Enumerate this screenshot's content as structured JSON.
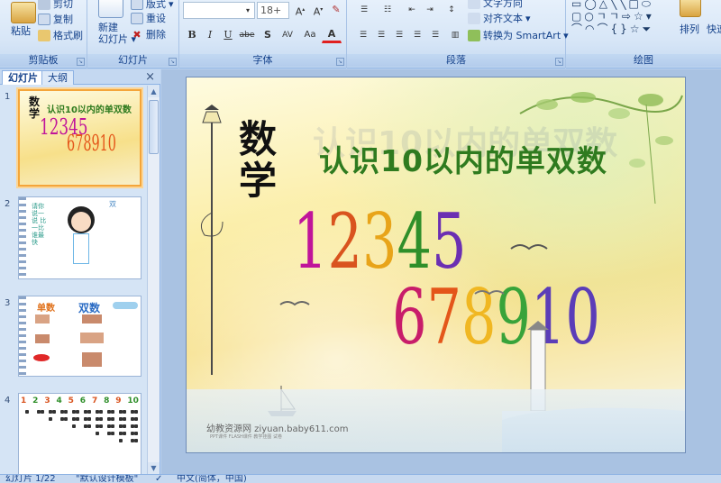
{
  "ribbon": {
    "clipboard": {
      "paste": "粘贴",
      "cut": "剪切",
      "copy": "复制",
      "format_painter": "格式刷",
      "label": "剪贴板"
    },
    "slides": {
      "new_slide_line1": "新建",
      "new_slide_line2": "幻灯片",
      "layout": "版式",
      "reset": "重设",
      "delete": "删除",
      "label": "幻灯片"
    },
    "font": {
      "font_name": "",
      "font_size": "18+",
      "label": "字体",
      "bold": "B",
      "italic": "I",
      "underline": "U",
      "strike": "abe",
      "shadow": "S",
      "spacing": "AV",
      "case": "Aa",
      "color": "A"
    },
    "paragraph": {
      "text_direction": "文字方向",
      "align_text": "对齐文本",
      "smartart": "转换为 SmartArt",
      "label": "段落"
    },
    "drawing": {
      "arrange": "排列",
      "quick_styles": "快速",
      "label": "绘图"
    }
  },
  "left_pane": {
    "tabs": [
      {
        "label": "幻灯片"
      },
      {
        "label": "大纲"
      }
    ],
    "close": "×",
    "thumbnails": [
      {
        "num": "1",
        "big": "数学",
        "title": "认识10以内的单双数",
        "row1": "12345",
        "row2": "678910"
      },
      {
        "num": "2",
        "caption": "双",
        "side_text": "请你说一说 比一比谁最快"
      },
      {
        "num": "3",
        "left": "单数",
        "right": "双数"
      },
      {
        "num": "4",
        "numbers": [
          "1",
          "2",
          "3",
          "4",
          "5",
          "6",
          "7",
          "8",
          "9",
          "10"
        ]
      }
    ]
  },
  "slide": {
    "big_title": "数学",
    "title": "认识10以内的单双数",
    "ghost_title": "认识10以内的单双数",
    "row1": [
      "1",
      "2",
      "3",
      "4",
      "5"
    ],
    "row2": [
      "6",
      "7",
      "8",
      "9",
      "10"
    ],
    "watermark": "幼教资源网 ziyuan.baby611.com",
    "watermark_small": "PPT课件 FLASH课件 教学挂图 试卷",
    "digit_colors": [
      "#c0149a",
      "#d9531e",
      "#e8a419",
      "#2f8f2a",
      "#6b2fb2",
      "#c81d6a",
      "#e4561a",
      "#f0b722",
      "#38a33a",
      "#5b3db8"
    ]
  },
  "status": {
    "slide_counter": "幻灯片 1/22",
    "theme": "\"默认设计模板\"",
    "language": "中文(简体，中国)"
  }
}
